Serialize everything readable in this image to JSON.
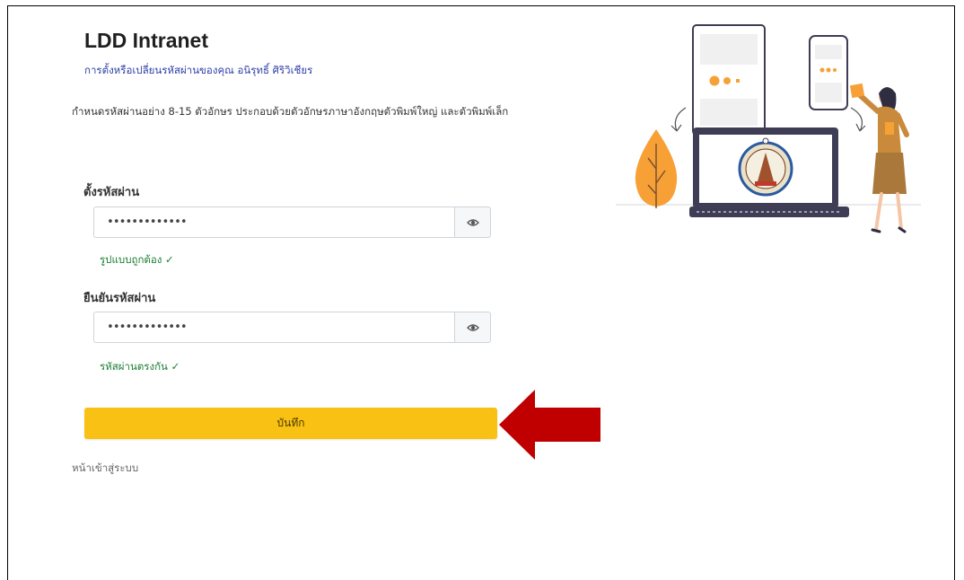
{
  "page": {
    "title": "LDD Intranet",
    "subtitle": "การตั้งหรือเปลี่ยนรหัสผ่านของคุณ อนิรุทธิ์ ศิริวิเชียร",
    "description": "กำหนดรหัสผ่านอย่าง 8-15 ตัวอักษร ประกอบด้วยตัวอักษรภาษาอังกฤษตัวพิมพ์ใหญ่ และตัวพิมพ์เล็ก"
  },
  "form": {
    "password": {
      "label": "ตั้งรหัสผ่าน",
      "value": "•••••••••••••",
      "validation": "รูปแบบถูกต้อง ✓"
    },
    "confirm": {
      "label": "ยืนยันรหัสผ่าน",
      "value": "•••••••••••••",
      "validation": "รหัสผ่านตรงกัน ✓"
    },
    "save_label": "บันทึก",
    "login_link": "หน้าเข้าสู่ระบบ"
  },
  "icons": {
    "eye": "eye-icon",
    "arrow": "red-arrow-annotation"
  },
  "colors": {
    "title": "#1f1f1f",
    "subtitle": "#2f3fa8",
    "valid": "#1e7e34",
    "save_button": "#f8c114",
    "arrow": "#c00000",
    "illustration_accent": "#f7a036"
  }
}
